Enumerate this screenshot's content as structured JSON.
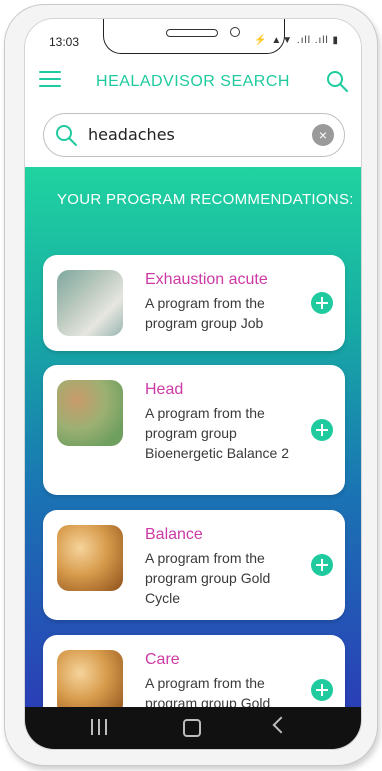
{
  "status_bar": {
    "time": "13:03",
    "indicators": "⚡ ▲▼ .ıll .ıll ▮"
  },
  "header": {
    "title": "HEALADVISOR SEARCH"
  },
  "search": {
    "value": "headaches",
    "clear_label": "×"
  },
  "recommendations": {
    "heading": "YOUR PROGRAM RECOMMENDATIONS:",
    "cards": [
      {
        "title": "Exhaustion acute",
        "desc": "A program from the program group Job",
        "image": "desk-coffee-thumbnail"
      },
      {
        "title": "Head",
        "desc": "A program from the program group Bioenergetic Balance 2",
        "image": "green-abstract-thumbnail"
      },
      {
        "title": "Balance",
        "desc": "A program from the program group Gold Cycle",
        "image": "gold-bokeh-thumbnail"
      },
      {
        "title": "Care",
        "desc": "A program from the program group Gold",
        "image": "gold-bokeh-thumbnail"
      }
    ]
  },
  "colors": {
    "accent": "#1fcb9e",
    "title_pink": "#cc3aa6",
    "gradient_top": "#20d3a0",
    "gradient_bottom": "#2a3fb6"
  },
  "icons": {
    "menu": "hamburger-menu-icon",
    "search": "magnifier-icon",
    "clear": "clear-circle-icon",
    "add": "plus-circle-icon",
    "nav_recents": "recents-icon",
    "nav_home": "home-icon",
    "nav_back": "back-chevron-icon"
  }
}
